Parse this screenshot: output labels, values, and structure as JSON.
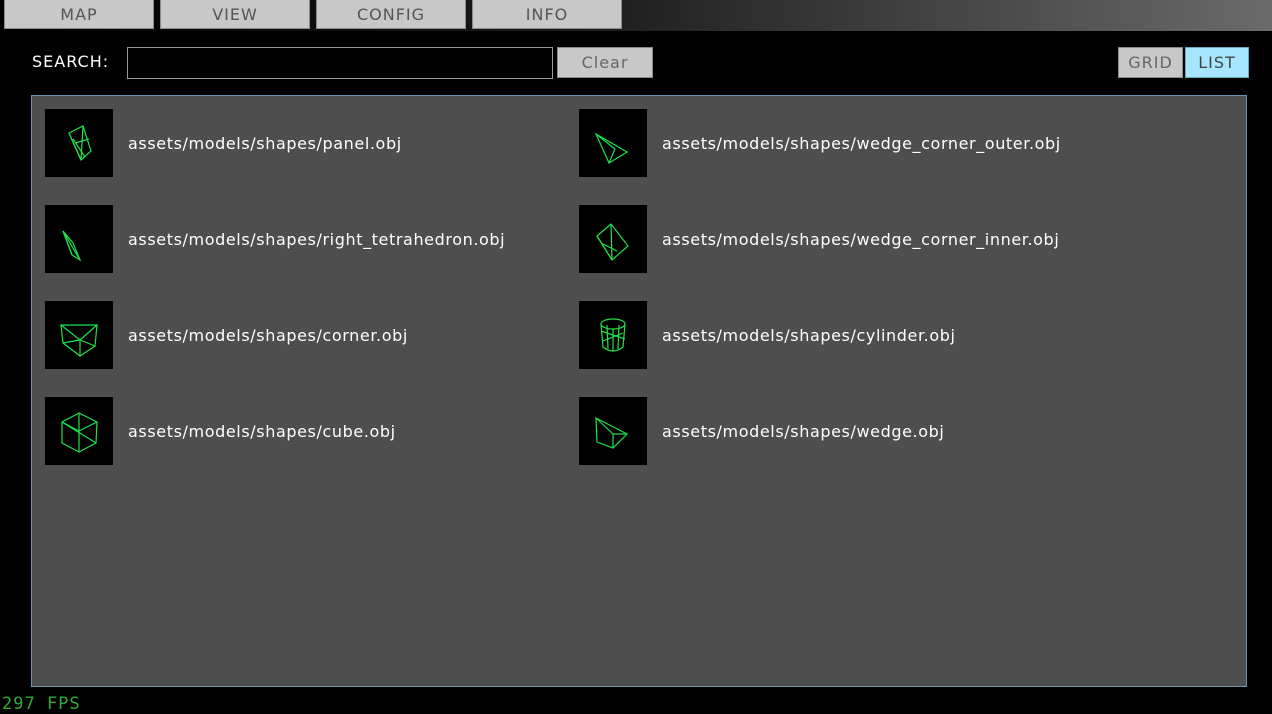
{
  "tabs": [
    {
      "label": "MAP"
    },
    {
      "label": "VIEW"
    },
    {
      "label": "CONFIG"
    },
    {
      "label": "INFO"
    }
  ],
  "search": {
    "label": "SEARCH:",
    "value": "",
    "clear_label": "Clear"
  },
  "view_toggle": {
    "grid_label": "GRID",
    "list_label": "LIST",
    "active": "LIST"
  },
  "models": [
    {
      "path": "assets/models/shapes/panel.obj",
      "icon": "panel-wireframe-icon"
    },
    {
      "path": "assets/models/shapes/wedge_corner_outer.obj",
      "icon": "wedge-corner-outer-wireframe-icon"
    },
    {
      "path": "assets/models/shapes/right_tetrahedron.obj",
      "icon": "right-tetrahedron-wireframe-icon"
    },
    {
      "path": "assets/models/shapes/wedge_corner_inner.obj",
      "icon": "wedge-corner-inner-wireframe-icon"
    },
    {
      "path": "assets/models/shapes/corner.obj",
      "icon": "corner-wireframe-icon"
    },
    {
      "path": "assets/models/shapes/cylinder.obj",
      "icon": "cylinder-wireframe-icon"
    },
    {
      "path": "assets/models/shapes/cube.obj",
      "icon": "cube-wireframe-icon"
    },
    {
      "path": "assets/models/shapes/wedge.obj",
      "icon": "wedge-wireframe-icon"
    }
  ],
  "fps": "297 FPS",
  "colors": {
    "accent": "#a6e6ff",
    "wireframe": "#1ee24a",
    "panel": "#4e4e4e",
    "fps": "#2fae2f"
  }
}
